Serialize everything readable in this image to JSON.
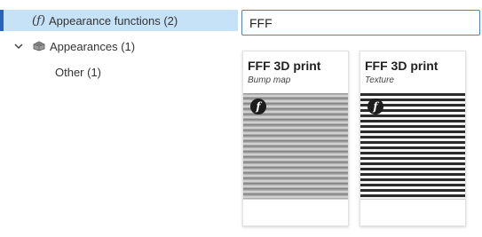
{
  "tree": {
    "appearance_functions": {
      "glyph": "(ƒ)",
      "label": "Appearance functions (2)"
    },
    "appearances": {
      "label": "Appearances (1)",
      "icon": "cube-grid-icon",
      "expand_icon": "chevron-down-icon"
    },
    "other": {
      "label": "Other (1)"
    }
  },
  "search": {
    "value": "FFF"
  },
  "cards": [
    {
      "title": "FFF 3D print",
      "subtitle": "Bump map",
      "badge": "f"
    },
    {
      "title": "FFF 3D print",
      "subtitle": "Texture",
      "badge": "f"
    }
  ],
  "colors": {
    "selection_bg": "#c6e2f7",
    "selection_accent": "#2a62b8",
    "search_border": "#2f8ce0"
  }
}
